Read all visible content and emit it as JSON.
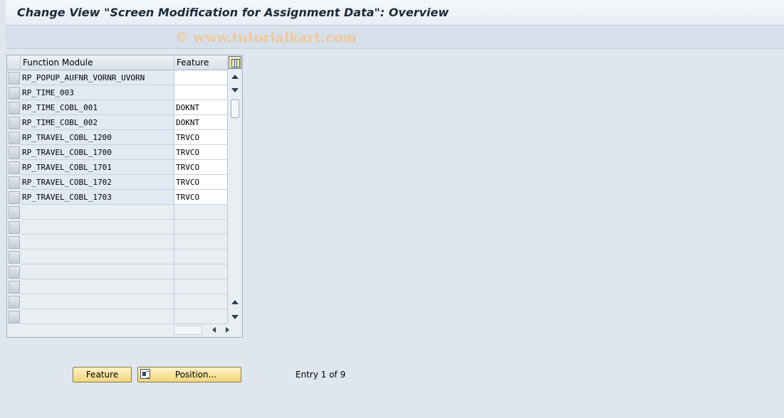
{
  "window": {
    "title": "Change View \"Screen Modification for Assignment Data\": Overview",
    "watermark": "© www.tutorialkart.com"
  },
  "table": {
    "columns": [
      "Function Module",
      "Feature"
    ],
    "rows": [
      {
        "function_module": "RP_POPUP_AUFNR_VORNR_UVORN",
        "feature": ""
      },
      {
        "function_module": "RP_TIME_003",
        "feature": ""
      },
      {
        "function_module": "RP_TIME_COBL_001",
        "feature": "DOKNT"
      },
      {
        "function_module": "RP_TIME_COBL_002",
        "feature": "DOKNT"
      },
      {
        "function_module": "RP_TRAVEL_COBL_1200",
        "feature": "TRVCO"
      },
      {
        "function_module": "RP_TRAVEL_COBL_1700",
        "feature": "TRVCO"
      },
      {
        "function_module": "RP_TRAVEL_COBL_1701",
        "feature": "TRVCO"
      },
      {
        "function_module": "RP_TRAVEL_COBL_1702",
        "feature": "TRVCO"
      },
      {
        "function_module": "RP_TRAVEL_COBL_1703",
        "feature": "TRVCO"
      }
    ],
    "empty_rows": 8,
    "config_icon": "table-settings-icon"
  },
  "buttons": {
    "feature_label": "Feature",
    "position_label": "Position...",
    "position_icon": "position-icon"
  },
  "status": {
    "entry_text": "Entry 1 of 9"
  }
}
